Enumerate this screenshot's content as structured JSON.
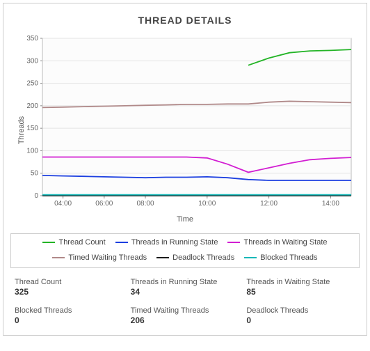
{
  "title": "THREAD DETAILS",
  "chart_data": {
    "type": "line",
    "xlabel": "Time",
    "ylabel": "Threads",
    "ylim": [
      0,
      350
    ],
    "yticks": [
      0,
      50,
      100,
      150,
      200,
      250,
      300,
      350
    ],
    "xticks": [
      "04:00",
      "06:00",
      "08:00",
      "10:00",
      "12:00",
      "14:00"
    ],
    "x": [
      "03:00",
      "04:00",
      "05:00",
      "06:00",
      "07:00",
      "08:00",
      "09:00",
      "09:30",
      "10:00",
      "11:00",
      "11:45",
      "12:00",
      "12:15",
      "13:00",
      "14:00",
      "15:00"
    ],
    "series": [
      {
        "name": "Thread Count",
        "color": "#23b426",
        "values": [
          null,
          null,
          null,
          null,
          null,
          null,
          null,
          null,
          null,
          null,
          290,
          306,
          318,
          322,
          323,
          325
        ]
      },
      {
        "name": "Threads in Running State",
        "color": "#1c3fe0",
        "values": [
          45,
          44,
          43,
          42,
          41,
          40,
          41,
          41,
          42,
          40,
          36,
          34,
          34,
          34,
          34,
          34
        ]
      },
      {
        "name": "Threads in Waiting State",
        "color": "#d21ed2",
        "values": [
          86,
          86,
          86,
          86,
          86,
          86,
          86,
          86,
          84,
          70,
          52,
          62,
          72,
          80,
          83,
          85
        ]
      },
      {
        "name": "Timed Waiting Threads",
        "color": "#b08989",
        "values": [
          196,
          197,
          198,
          199,
          200,
          201,
          202,
          203,
          203,
          204,
          204,
          208,
          210,
          209,
          208,
          207
        ]
      },
      {
        "name": "Deadlock Threads",
        "color": "#1a1a1a",
        "values": [
          0,
          0,
          0,
          0,
          0,
          0,
          0,
          0,
          0,
          0,
          0,
          0,
          0,
          0,
          0,
          0
        ]
      },
      {
        "name": "Blocked Threads",
        "color": "#18b8b8",
        "values": [
          2,
          2,
          2,
          2,
          2,
          2,
          2,
          2,
          2,
          2,
          2,
          2,
          2,
          2,
          2,
          2
        ]
      }
    ]
  },
  "legend": [
    {
      "label": "Thread Count",
      "color": "#23b426"
    },
    {
      "label": "Threads in Running State",
      "color": "#1c3fe0"
    },
    {
      "label": "Threads in Waiting State",
      "color": "#d21ed2"
    },
    {
      "label": "Timed Waiting Threads",
      "color": "#b08989"
    },
    {
      "label": "Deadlock Threads",
      "color": "#1a1a1a"
    },
    {
      "label": "Blocked Threads",
      "color": "#18b8b8"
    }
  ],
  "stats": [
    {
      "label": "Thread Count",
      "value": "325"
    },
    {
      "label": "Threads in Running State",
      "value": "34"
    },
    {
      "label": "Threads in Waiting State",
      "value": "85"
    },
    {
      "label": "Blocked Threads",
      "value": "0"
    },
    {
      "label": "Timed Waiting Threads",
      "value": "206"
    },
    {
      "label": "Deadlock Threads",
      "value": "0"
    }
  ]
}
